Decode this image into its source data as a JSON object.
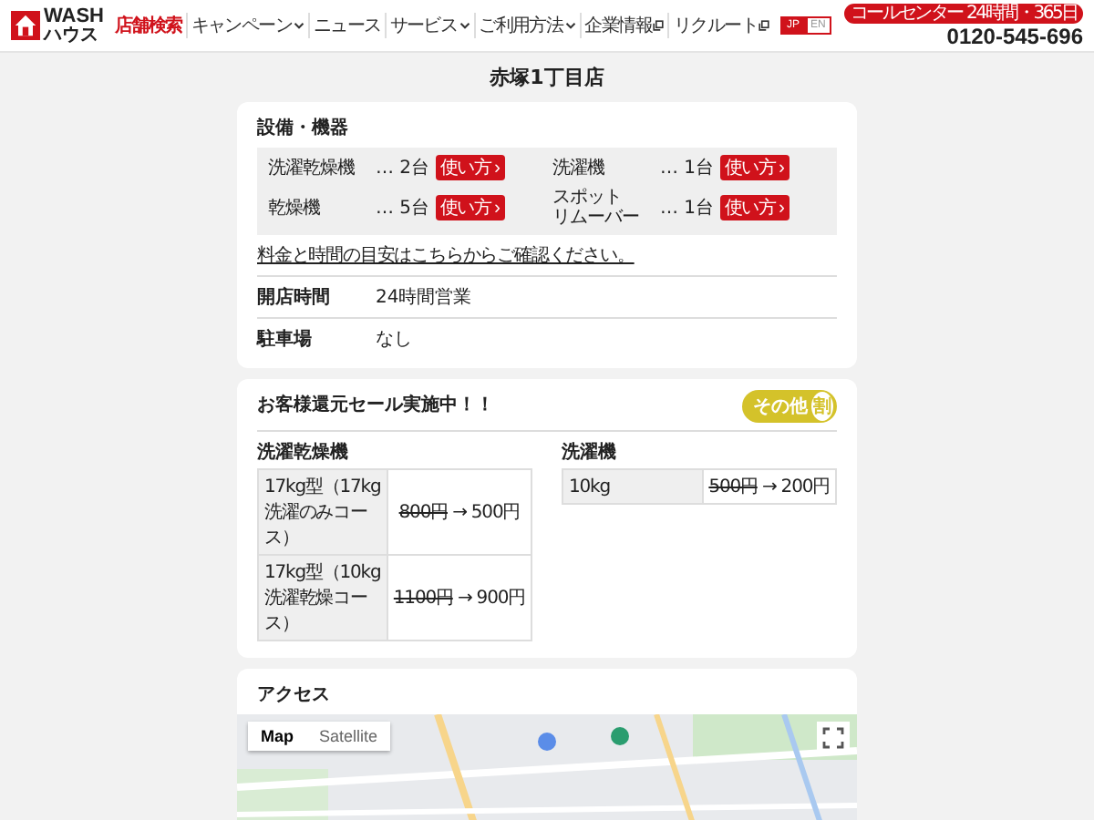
{
  "header": {
    "logo_top": "WASH",
    "logo_bottom": "ハウス",
    "nav": [
      {
        "label": "店舗検索",
        "selected": true,
        "kind": "plain"
      },
      {
        "label": "キャンペーン",
        "selected": false,
        "kind": "dropdown"
      },
      {
        "label": "ニュース",
        "selected": false,
        "kind": "plain"
      },
      {
        "label": "サービス",
        "selected": false,
        "kind": "dropdown"
      },
      {
        "label": "ご利用方法",
        "selected": false,
        "kind": "dropdown"
      },
      {
        "label": "企業情報",
        "selected": false,
        "kind": "external"
      },
      {
        "label": "リクルート",
        "selected": false,
        "kind": "external"
      }
    ],
    "languages": [
      {
        "label": "JP",
        "selected": true
      },
      {
        "label": "EN",
        "selected": false
      }
    ],
    "call_center": "コールセンター 24時間・365日",
    "phone": "0120-545-696"
  },
  "page_title": "赤塚1丁目店",
  "facilities": {
    "heading": "設備・機器",
    "machines": [
      {
        "name": [
          "洗濯乾燥機"
        ],
        "count": "… 2台",
        "button": "使い方 ›"
      },
      {
        "name": [
          "洗濯機"
        ],
        "count": "… 1台",
        "button": "使い方 ›"
      },
      {
        "name": [
          "乾燥機"
        ],
        "count": "… 5台",
        "button": "使い方 ›"
      },
      {
        "name": [
          "スポット",
          "リムーバー"
        ],
        "count": "… 1台",
        "button": "使い方 ›"
      }
    ],
    "link": "料金と時間の目安はこちらからご確認ください。",
    "info": [
      {
        "label": "開店時間",
        "value": "24時間営業"
      },
      {
        "label": "駐車場",
        "value": "なし"
      }
    ]
  },
  "sale": {
    "heading": "お客様還元セール実施中！！",
    "badge": "その他",
    "badge_icon": "割",
    "tables": [
      {
        "title": "洗濯乾燥機",
        "rows": [
          {
            "type": "17kg型（17kg洗濯のみコース）",
            "old": "800円",
            "arrow": "→",
            "new": "500円"
          },
          {
            "type": "17kg型（10kg洗濯乾燥コース）",
            "old": "1100円",
            "arrow": "→",
            "new": "900円"
          }
        ]
      },
      {
        "title": "洗濯機",
        "rows": [
          {
            "type": "10kg",
            "old": "500円",
            "arrow": "→",
            "new": "200円"
          }
        ]
      }
    ]
  },
  "access": {
    "heading": "アクセス",
    "map_types": [
      {
        "label": "Map",
        "selected": true
      },
      {
        "label": "Satellite",
        "selected": false
      }
    ]
  }
}
